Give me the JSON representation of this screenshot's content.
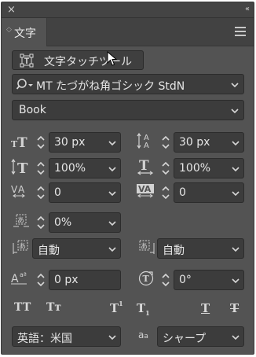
{
  "window": {
    "close_glyph": "×",
    "collapse_glyph": "‹‹"
  },
  "tab": {
    "label": "文字"
  },
  "tool_button": {
    "label": "文字タッチツール"
  },
  "font_family": {
    "value": "MT たづがね角ゴシック StdN"
  },
  "font_style": {
    "value": "Book"
  },
  "font_size": {
    "value": "30 px"
  },
  "leading": {
    "value": "30 px"
  },
  "vertical_scale": {
    "value": "100%"
  },
  "horizontal_scale": {
    "value": "100%"
  },
  "kerning": {
    "value": "0"
  },
  "tracking": {
    "value": "0"
  },
  "tsume": {
    "value": "0%"
  },
  "aki_left": {
    "value": "自動"
  },
  "aki_right": {
    "value": "自動"
  },
  "baseline_shift": {
    "value": "0 px"
  },
  "rotation": {
    "value": "0°"
  },
  "text_styles": {
    "all_caps": "TT",
    "small_caps": "Tт",
    "superscript": "T",
    "subscript": "T",
    "underline": "T",
    "strikethrough": "T"
  },
  "language": {
    "value": "英語：米国"
  },
  "antialias": {
    "value": "シャープ",
    "icon_label_a": "a",
    "icon_label_a_sub": "a"
  },
  "colors": {
    "panel_bg": "#535353",
    "field_bg": "#3c3c3c",
    "text": "#e6e6e6"
  }
}
